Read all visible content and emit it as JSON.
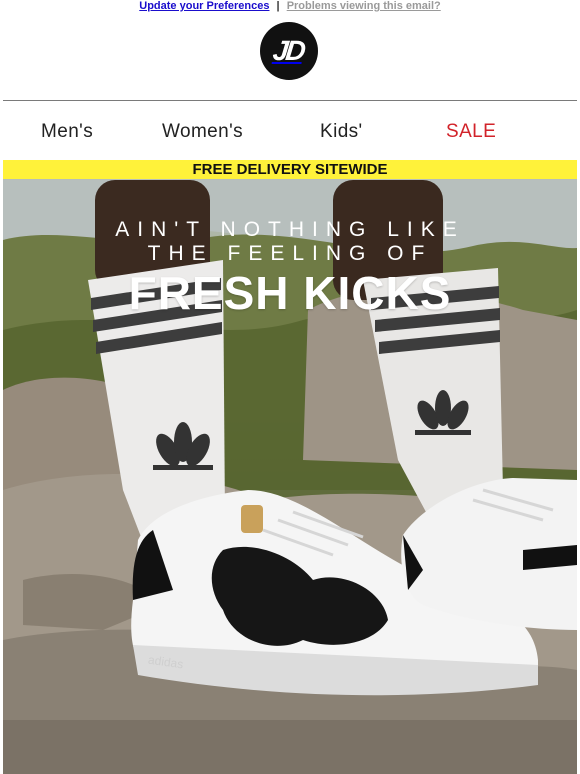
{
  "preheader": {
    "preferences_link": "Update your Preferences",
    "separator": "|",
    "problems_link": "Problems viewing this email?"
  },
  "logo": {
    "text": "JD"
  },
  "nav": {
    "items": [
      {
        "label": "Men's"
      },
      {
        "label": "Women's"
      },
      {
        "label": "Kids'"
      },
      {
        "label": "SALE"
      }
    ],
    "sale_color": "#d2232a"
  },
  "hero": {
    "banner_text": "FREE DELIVERY SITEWIDE",
    "banner_color": "#fff23a",
    "headline_line1": "AIN'T NOTHING LIKE",
    "headline_line2": "THE FEELING OF",
    "headline_line3": "FRESH KICKS",
    "shoe_brand_text": "adidas"
  }
}
